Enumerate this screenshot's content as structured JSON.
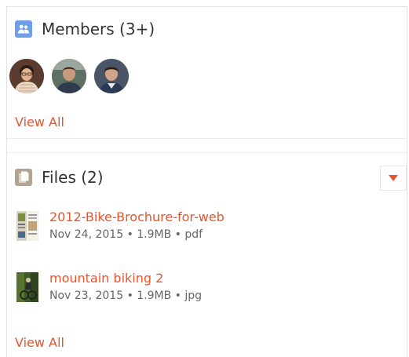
{
  "members": {
    "title": "Members (3+)",
    "icon": "group-icon",
    "avatars": [
      {
        "name": "member-avatar-1"
      },
      {
        "name": "member-avatar-2"
      },
      {
        "name": "member-avatar-3"
      }
    ],
    "view_all_label": "View All"
  },
  "files": {
    "title": "Files (2)",
    "icon": "document-icon",
    "dropdown_icon": "caret-down-icon",
    "items": [
      {
        "name": "2012-Bike-Brochure-for-web",
        "meta": "Nov 24, 2015 • 1.9MB • pdf",
        "thumb_icon": "brochure-thumbnail"
      },
      {
        "name": "mountain biking 2",
        "meta": "Nov 23, 2015 • 1.9MB • jpg",
        "thumb_icon": "photo-thumbnail"
      }
    ],
    "view_all_label": "View All"
  },
  "colors": {
    "accent": "#e8542c",
    "members_icon_bg": "#6f9ee9",
    "files_icon_bg": "#b3a491",
    "text": "#333333",
    "muted": "#666666"
  }
}
